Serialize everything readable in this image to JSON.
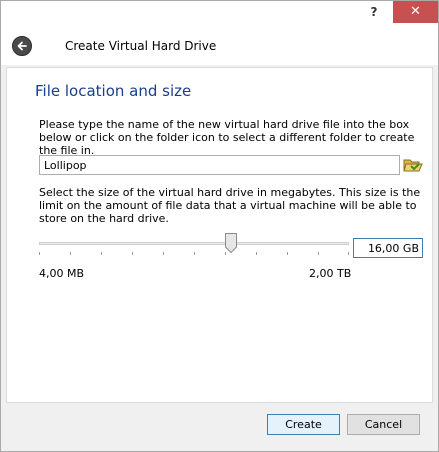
{
  "titlebar": {
    "help_label": "?",
    "close_label": "✕"
  },
  "header": {
    "title": "Create Virtual Hard Drive"
  },
  "main": {
    "section_title": "File location and size",
    "location_instructions": "Please type the name of the new virtual hard drive file into the box below or click on the folder icon to select a different folder to create the file in.",
    "file_name": "Lollipop",
    "size_instructions": "Select the size of the virtual hard drive in megabytes. This size is the limit on the amount of file data that a virtual machine will be able to store on the hard drive.",
    "size_value": "16,00 GB",
    "slider_position_fraction": 0.62,
    "slider_min_label": "4,00 MB",
    "slider_max_label": "2,00 TB"
  },
  "footer": {
    "create_label": "Create",
    "cancel_label": "Cancel"
  },
  "icons": {
    "back": "back-arrow-icon",
    "folder": "folder-open-icon"
  },
  "colors": {
    "accent": "#1a3e8c",
    "close_button": "#c75050"
  }
}
